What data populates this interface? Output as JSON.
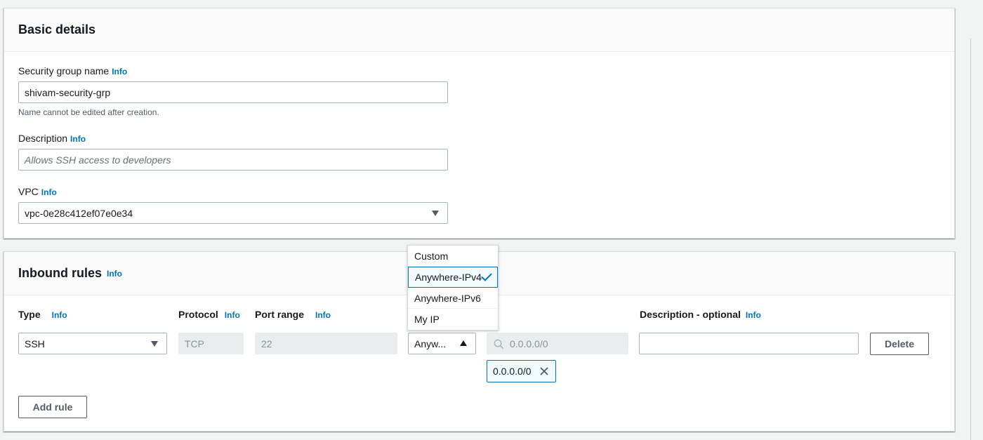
{
  "basic": {
    "title": "Basic details",
    "sg_name_label": "Security group name",
    "info": "Info",
    "sg_name_value": "shivam-security-grp",
    "sg_name_hint": "Name cannot be edited after creation.",
    "description_label": "Description",
    "description_placeholder": "Allows SSH access to developers",
    "vpc_label": "VPC",
    "vpc_value": "vpc-0e28c412ef07e0e34"
  },
  "inbound": {
    "title": "Inbound rules",
    "info": "Info",
    "columns": {
      "type": "Type",
      "protocol": "Protocol",
      "port_range": "Port range",
      "description": "Description - optional"
    },
    "row": {
      "type": "SSH",
      "protocol": "TCP",
      "port_range": "22",
      "source_type": "Anyw...",
      "source_search_placeholder": "0.0.0.0/0",
      "source_token": "0.0.0.0/0",
      "description": "",
      "delete_label": "Delete"
    },
    "add_rule_label": "Add rule",
    "source_options": [
      {
        "label": "Custom",
        "selected": false
      },
      {
        "label": "Anywhere-IPv4",
        "selected": true
      },
      {
        "label": "Anywhere-IPv6",
        "selected": false
      },
      {
        "label": "My IP",
        "selected": false
      }
    ]
  },
  "colors": {
    "link": "#0073bb",
    "text": "#16191f",
    "background": "#f2f3f3"
  }
}
